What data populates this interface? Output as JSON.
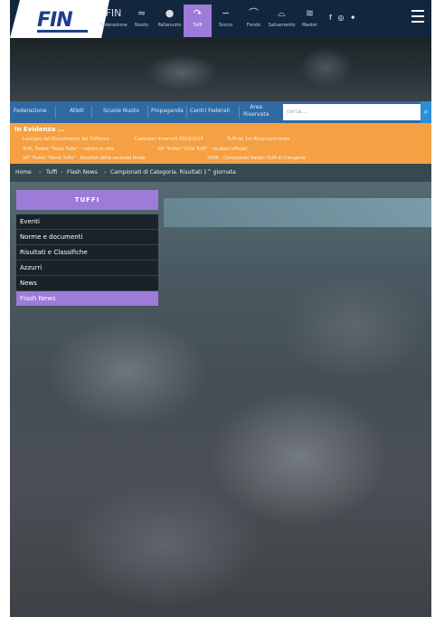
{
  "header": {
    "logo_text": "FIN",
    "disciplines": [
      {
        "label": "Federazione",
        "icon": "fin-logo-icon",
        "glyph": "FIN",
        "active": false
      },
      {
        "label": "Nuoto",
        "icon": "swimmer-icon",
        "glyph": "≈",
        "active": false
      },
      {
        "label": "Pallanuoto",
        "icon": "waterpolo-icon",
        "glyph": "●",
        "active": false
      },
      {
        "label": "Tuffi",
        "icon": "diver-icon",
        "glyph": "↷",
        "active": true
      },
      {
        "label": "Sincro",
        "icon": "synchro-icon",
        "glyph": "∽",
        "active": false
      },
      {
        "label": "Fondo",
        "icon": "open-water-icon",
        "glyph": "⌒",
        "active": false
      },
      {
        "label": "Salvamento",
        "icon": "lifesaving-icon",
        "glyph": "⌓",
        "active": false
      },
      {
        "label": "Master",
        "icon": "master-icon",
        "glyph": "≋",
        "active": false
      }
    ],
    "social_glyphs": "f ◎ ✦"
  },
  "nav": {
    "items": [
      "Federazione",
      "Atleti",
      "Scuole Nuoto",
      "Propaganda",
      "Centri Federali"
    ],
    "two_line_item": [
      "Area",
      "Riservata"
    ],
    "search_placeholder": "cerca..."
  },
  "evidence": {
    "title": "In Evidenza ...",
    "links": [
      "Lanciare del Ricevimento del Tuffatore",
      "Calendari Invernali 2014/2015",
      "Tuffi da 1m Riconoscimento",
      "Tuffi, Trofeo \"Paolo Tuffo\" - notizie in rete",
      "VII° Trofeo \"Città Tuffi\" - risultati ufficiali",
      "VII° Trofeo \"Paolo Tuffo\" - Risultati della seconda finale",
      "2008 - Campionati Italiani Tuffi di Categoria"
    ]
  },
  "breadcrumb": [
    "Home",
    "Tuffi",
    "Flash News",
    "Campionati di Categoria. Risultati 1^ giornata"
  ],
  "sidebar": {
    "title": "TUFFI",
    "items": [
      "Eventi",
      "Norme e documenti",
      "Risultati e Classifiche",
      "Azzurri",
      "News",
      "Flash News"
    ],
    "active_index": 5
  },
  "colors": {
    "accent_purple": "#9d7bd8",
    "nav_blue": "#2f6aa3",
    "evidence_orange": "#f5a043",
    "topbar_navy": "#12263d"
  }
}
